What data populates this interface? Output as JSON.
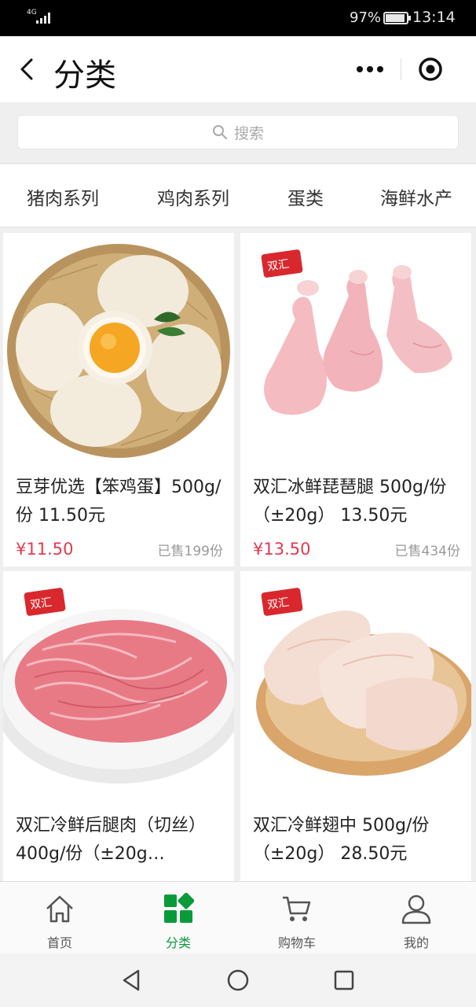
{
  "status_bar": {
    "network": "4G",
    "battery": "97%",
    "time": "13:14"
  },
  "header": {
    "title": "分类",
    "back_icon": "chevron-left-icon",
    "more_icon": "more-dots-icon",
    "close_icon": "record-close-icon"
  },
  "search": {
    "placeholder": "搜索"
  },
  "categories": [
    {
      "label": "猪肉系列"
    },
    {
      "label": "鸡肉系列"
    },
    {
      "label": "蛋类"
    },
    {
      "label": "海鲜水产"
    }
  ],
  "products": [
    {
      "name": "豆芽优选【笨鸡蛋】500g/份 11.50元",
      "price": "¥11.50",
      "sold": "已售199份",
      "image": "eggs-in-basket"
    },
    {
      "name": "双汇冰鲜琵琶腿 500g/份（±20g） 13.50元",
      "price": "¥13.50",
      "sold": "已售434份",
      "image": "chicken-drumsticks",
      "brand": "双汇"
    },
    {
      "name": "双汇冷鲜后腿肉（切丝）400g/份（±20g…",
      "price": "",
      "sold": "",
      "image": "shredded-pork",
      "brand": "双汇"
    },
    {
      "name": "双汇冷鲜翅中 500g/份（±20g） 28.50元",
      "price": "",
      "sold": "",
      "image": "chicken-wings",
      "brand": "双汇"
    }
  ],
  "tabbar": [
    {
      "label": "首页",
      "icon": "home-icon"
    },
    {
      "label": "分类",
      "icon": "category-icon",
      "active": true
    },
    {
      "label": "购物车",
      "icon": "cart-icon"
    },
    {
      "label": "我的",
      "icon": "profile-icon"
    }
  ],
  "colors": {
    "accent_green": "#0a9a3a",
    "price_red": "#e23a4f",
    "brand_red": "#d8282e"
  }
}
